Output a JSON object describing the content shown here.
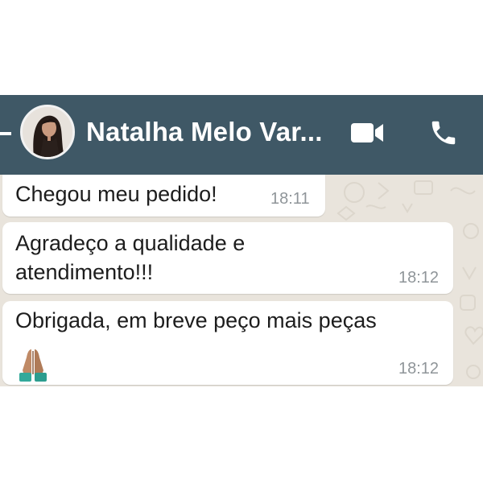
{
  "header": {
    "contact_name": "Natalha Melo Var...",
    "back_icon": "arrow-left-icon",
    "video_icon": "video-camera-icon",
    "call_icon": "phone-icon",
    "bar_color": "#3f5866"
  },
  "messages": [
    {
      "text": "Chegou meu pedido!",
      "time": "18:11"
    },
    {
      "text": "Agradeço a qualidade e\natendimento!!!",
      "time": "18:12"
    },
    {
      "text": "Obrigada, em breve peço mais peças",
      "emoji": "folded-hands-emoji",
      "time": "18:12"
    }
  ],
  "colors": {
    "chat_background": "#e9e4dc",
    "bubble": "#ffffff",
    "timestamp": "#8f9599"
  }
}
